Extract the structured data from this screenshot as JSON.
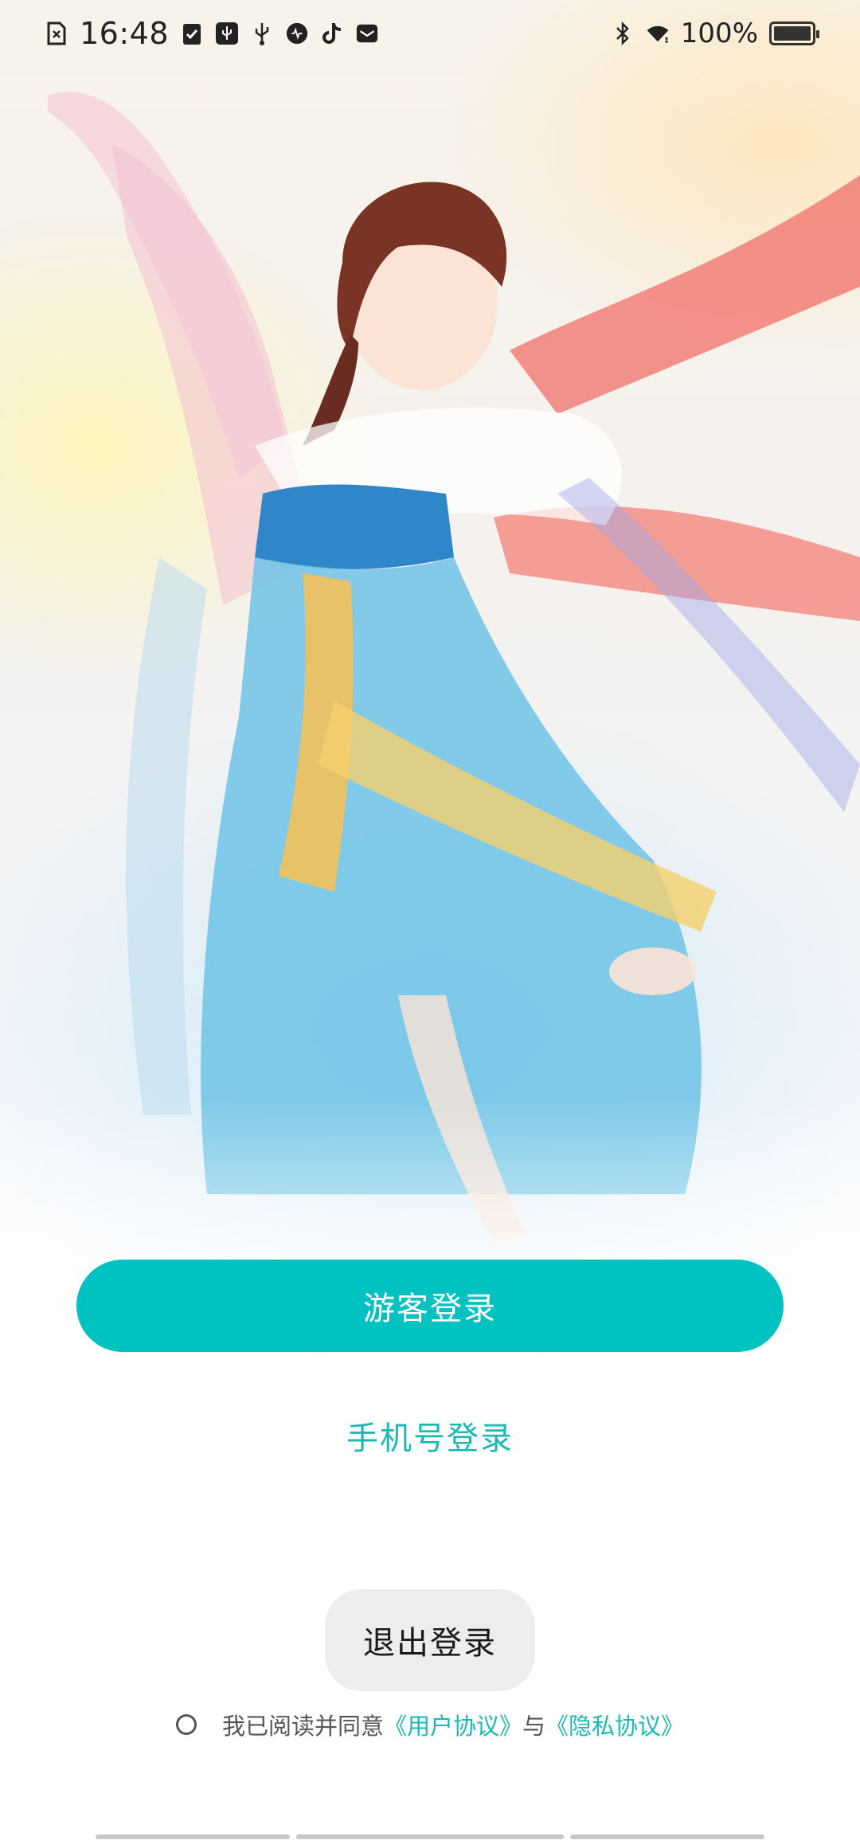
{
  "status_bar": {
    "time": "16:48",
    "battery_percent": "100%",
    "left_icons": [
      "sim-error-icon",
      "clipboard-check-icon",
      "usb-debug-icon",
      "usb-icon",
      "recording-icon",
      "tiktok-icon",
      "mail-icon"
    ],
    "right_icons": [
      "bluetooth-icon",
      "wifi-icon",
      "battery-icon"
    ]
  },
  "hero": {
    "description_icon": "dancer-illustration"
  },
  "actions": {
    "guest_login": "游客登录",
    "phone_login": "手机号登录",
    "logout": "退出登录"
  },
  "agreement": {
    "prefix": "我已阅读并同意",
    "user_agreement": "《用户协议》",
    "conjunction": "与",
    "privacy_policy": "《隐私协议》"
  },
  "colors": {
    "accent": "#00c2c0",
    "link": "#1bb8b4",
    "logout_bg": "#ededed"
  }
}
